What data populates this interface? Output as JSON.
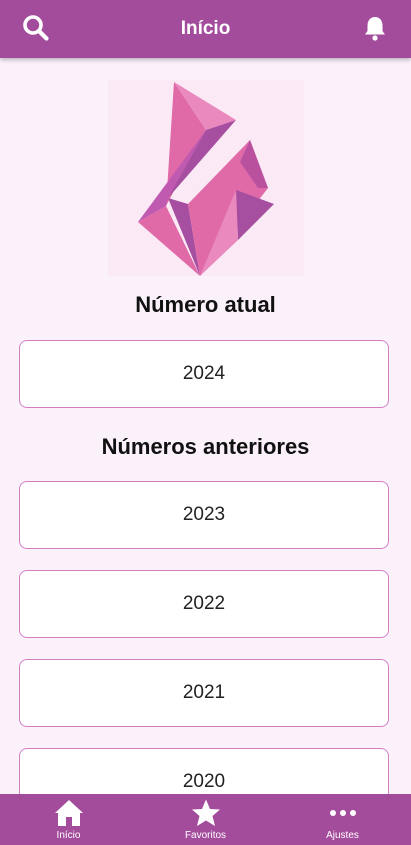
{
  "header": {
    "title": "Início",
    "left_icon": "search-icon",
    "right_icon": "bell-icon"
  },
  "main": {
    "current_title": "Número atual",
    "current_item": "2024",
    "previous_title": "Números anteriores",
    "previous_items": [
      "2023",
      "2022",
      "2021",
      "2020"
    ]
  },
  "bottom_nav": {
    "items": [
      {
        "label": "Início",
        "icon": "home-icon"
      },
      {
        "label": "Favoritos",
        "icon": "star-icon"
      },
      {
        "label": "Ajustes",
        "icon": "more-icon"
      }
    ]
  },
  "colors": {
    "accent": "#a44c9c",
    "background": "#fbf1fb",
    "card_border": "#d37fc4"
  }
}
